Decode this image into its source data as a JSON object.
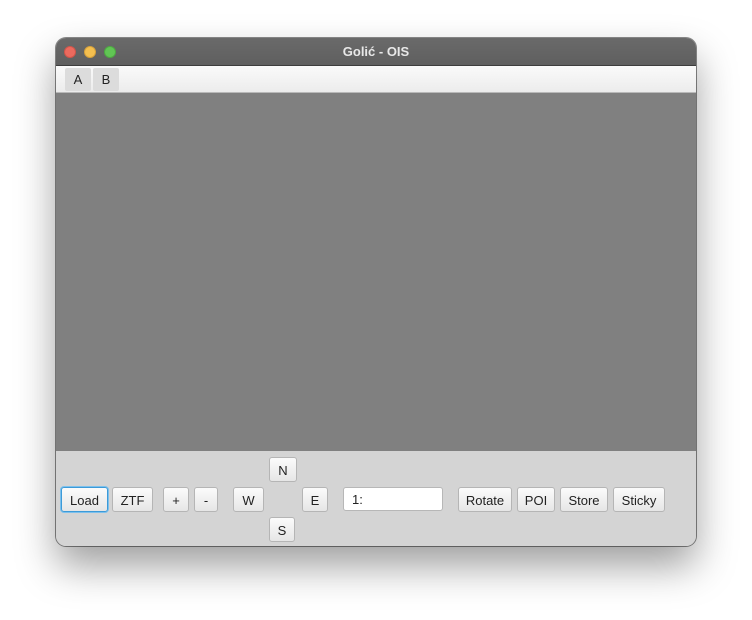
{
  "window": {
    "title": "Golić - OIS"
  },
  "menubar": {
    "items": [
      {
        "label": "A"
      },
      {
        "label": "B"
      }
    ]
  },
  "toolbar": {
    "load_label": "Load",
    "ztf_label": "ZTF",
    "zoom_in_label": "+",
    "zoom_out_label": "-",
    "west_label": "W",
    "north_label": "N",
    "south_label": "S",
    "east_label": "E",
    "scale_field_value": "1:",
    "rotate_label": "Rotate",
    "poi_label": "POI",
    "store_label": "Store",
    "sticky_label": "Sticky"
  },
  "colors": {
    "canvas": "#808080",
    "toolbar_bg": "#d4d4d4",
    "titlebar": "#636363",
    "focus_ring": "#3c9ad8"
  }
}
